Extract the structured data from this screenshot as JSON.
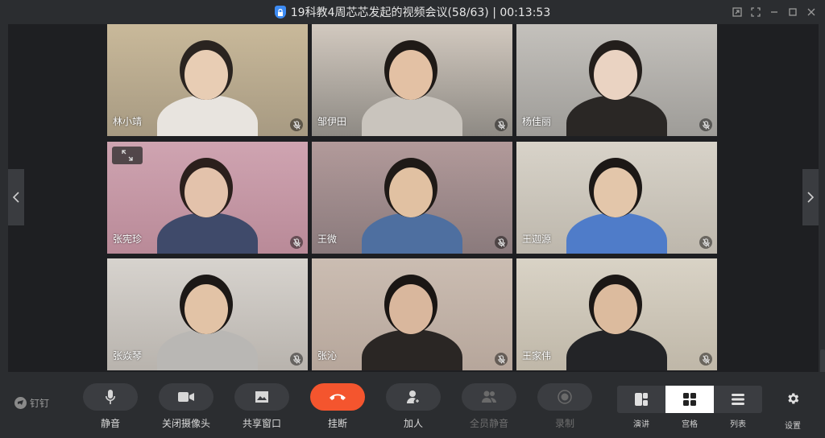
{
  "window": {
    "title": "19科教4周芯芯发起的视频会议(58/63) | 00:13:53"
  },
  "participants": [
    {
      "name": "林小靖",
      "mic": "muted",
      "bg": "#a79a82",
      "wall": "#c9b99a",
      "skin": "#e8cdb4",
      "hair": "#2a2420",
      "shirt": "#e8e4df"
    },
    {
      "name": "邹伊田",
      "mic": "muted",
      "bg": "#8e8a84",
      "wall": "#d2c9bf",
      "skin": "#e3c1a4",
      "hair": "#1f1a17",
      "shirt": "#c9c4bd"
    },
    {
      "name": "杨佳丽",
      "mic": "muted",
      "bg": "#9e9c98",
      "wall": "#c4c1bc",
      "skin": "#ead3c2",
      "hair": "#231e1b",
      "shirt": "#2a2725"
    },
    {
      "name": "张宪珍",
      "mic": "muted",
      "bg": "#b98a98",
      "wall": "#cfa4b1",
      "skin": "#e3c2ab",
      "hair": "#2b1f1c",
      "shirt": "#3f4a6a"
    },
    {
      "name": "王微",
      "mic": "muted",
      "bg": "#8a7a7c",
      "wall": "#b29a9a",
      "skin": "#e1c1a2",
      "hair": "#1f1a17",
      "shirt": "#4e6fa0"
    },
    {
      "name": "王迦源",
      "mic": "muted",
      "bg": "#bdb7ac",
      "wall": "#d8d3c9",
      "skin": "#e3c6aa",
      "hair": "#1c1816",
      "shirt": "#4f7cc9"
    },
    {
      "name": "张焱琴",
      "mic": "muted",
      "bg": "#b8b3ad",
      "wall": "#d7d3ce",
      "skin": "#e2c3a6",
      "hair": "#1c1816",
      "shirt": "#b9b7b4"
    },
    {
      "name": "张沁",
      "mic": "muted",
      "bg": "#b6a69b",
      "wall": "#cbbdb2",
      "skin": "#d9b79d",
      "hair": "#1a1614",
      "shirt": "#2a2624"
    },
    {
      "name": "王家伟",
      "mic": "muted",
      "bg": "#bfb7a8",
      "wall": "#d9d3c6",
      "skin": "#dcbb9e",
      "hair": "#1b1715",
      "shirt": "#232427"
    }
  ],
  "toolbar": {
    "brand": "钉钉",
    "buttons": [
      {
        "label": "静音",
        "icon": "mic-icon",
        "state": "enabled"
      },
      {
        "label": "关闭摄像头",
        "icon": "camera-icon",
        "state": "enabled"
      },
      {
        "label": "共享窗口",
        "icon": "share-screen-icon",
        "state": "enabled"
      },
      {
        "label": "挂断",
        "icon": "hangup-icon",
        "state": "danger"
      },
      {
        "label": "加人",
        "icon": "add-person-icon",
        "state": "enabled"
      },
      {
        "label": "全员静音",
        "icon": "mute-all-icon",
        "state": "disabled"
      },
      {
        "label": "录制",
        "icon": "record-icon",
        "state": "disabled"
      }
    ],
    "layouts": [
      {
        "label": "演讲",
        "icon": "speaker-layout-icon",
        "active": false
      },
      {
        "label": "宫格",
        "icon": "grid-layout-icon",
        "active": true
      },
      {
        "label": "列表",
        "icon": "list-layout-icon",
        "active": false
      }
    ],
    "settings_label": "设置"
  },
  "colors": {
    "accent_blue": "#3d8bf2",
    "hangup_red": "#f4552e",
    "toolbar_bg": "#2b2d30",
    "stage_bg": "#1e1f22"
  }
}
